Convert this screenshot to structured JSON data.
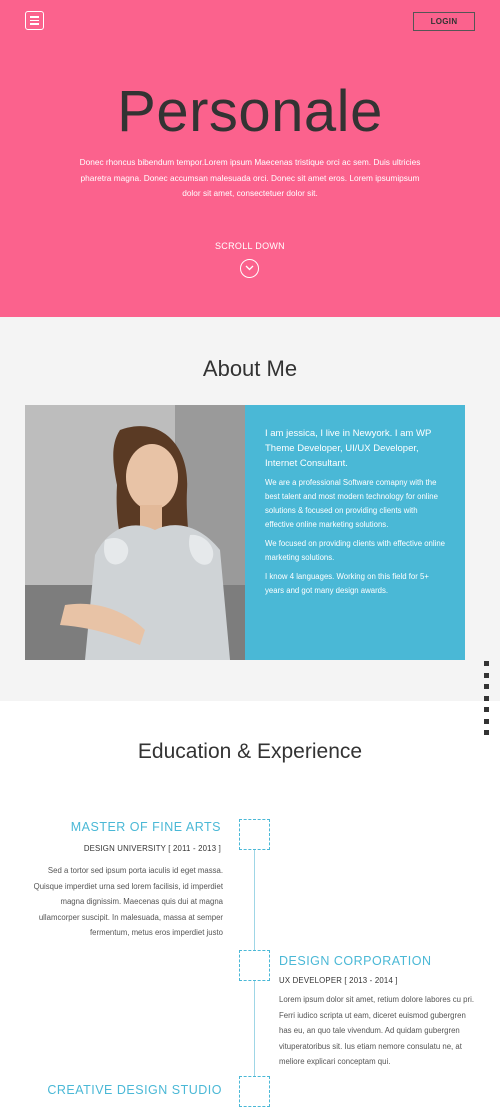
{
  "header": {
    "menu_icon": "hamburger-menu-icon",
    "login_label": "LOGIN"
  },
  "hero": {
    "title": "Personale",
    "text": "Donec rhoncus bibendum tempor.Lorem ipsum Maecenas tristique orci ac sem. Duis ultricies pharetra magna. Donec accumsan malesuada orci. Donec sit amet eros. Lorem ipsumipsum dolor sit amet, consectetuer dolor sit.",
    "scroll_label": "SCROLL DOWN",
    "scroll_icon": "chevron-down-circle-icon",
    "background": "#fb628d"
  },
  "about": {
    "title": "About Me",
    "lead": "I am jessica, I live in Newyork. I am WP Theme Developer, UI/UX Developer, Internet Consultant.",
    "paragraphs": [
      "We are a professional Software comapny with the best talent and most modern technology for online solutions & focused on providing clients with effective online marketing solutions.",
      "We focused on providing clients with effective online marketing solutions.",
      "I know 4 languages. Working on this field for 5+ years and got many design awards."
    ],
    "accent": "#4ab8d6"
  },
  "side_nav": {
    "dot_count": 7
  },
  "education": {
    "title": "Education & Experience",
    "entries": [
      {
        "title": "MASTER OF FINE ARTS",
        "subtitle": "DESIGN UNIVERSITY [ 2011 - 2013 ]",
        "description": "Sed a tortor sed ipsum porta iaculis id eget massa. Quisque imperdiet urna sed lorem facilisis, id imperdiet magna dignissim. Maecenas quis dui at magna ullamcorper suscipit. In malesuada, massa at semper fermentum, metus eros imperdiet justo"
      },
      {
        "title": "DESIGN CORPORATION",
        "subtitle": "UX DEVELOPER [ 2013 - 2014 ]",
        "description": "Lorem ipsum dolor sit amet, retium dolore labores cu pri. Ferri iudico scripta ut eam, diceret euismod gubergren has eu, an quo tale vivendum. Ad quidam gubergren vituperatoribus sit. Ius etiam nemore consulatu ne, at meliore explicari conceptam qui."
      },
      {
        "title": "CREATIVE DESIGN STUDIO"
      }
    ]
  }
}
